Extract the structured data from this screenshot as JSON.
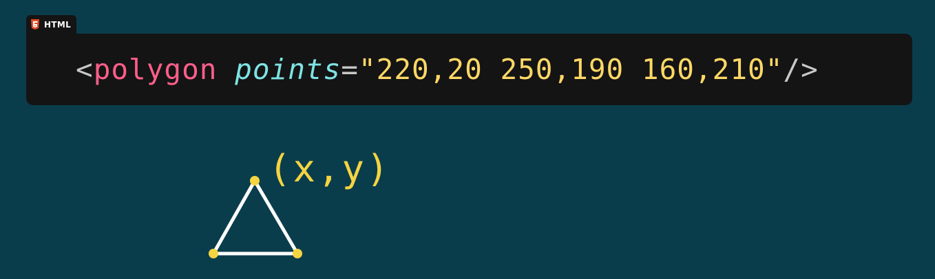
{
  "badge": {
    "language": "HTML",
    "icon": "html5-icon"
  },
  "code": {
    "open_bracket": "<",
    "tag": "polygon",
    "space": " ",
    "attr_name": "points",
    "equals": "=",
    "attr_value": "\"220,20 250,190 160,210\"",
    "close": "/>"
  },
  "diagram": {
    "vertex_label": "(x,y)"
  },
  "colors": {
    "background": "#0a3d4c",
    "panel": "#141414",
    "tag": "#ff5f8a",
    "attribute": "#7fe3e3",
    "string": "#ffd866",
    "vertex": "#f5d442",
    "html5_badge": "#e44d26"
  }
}
